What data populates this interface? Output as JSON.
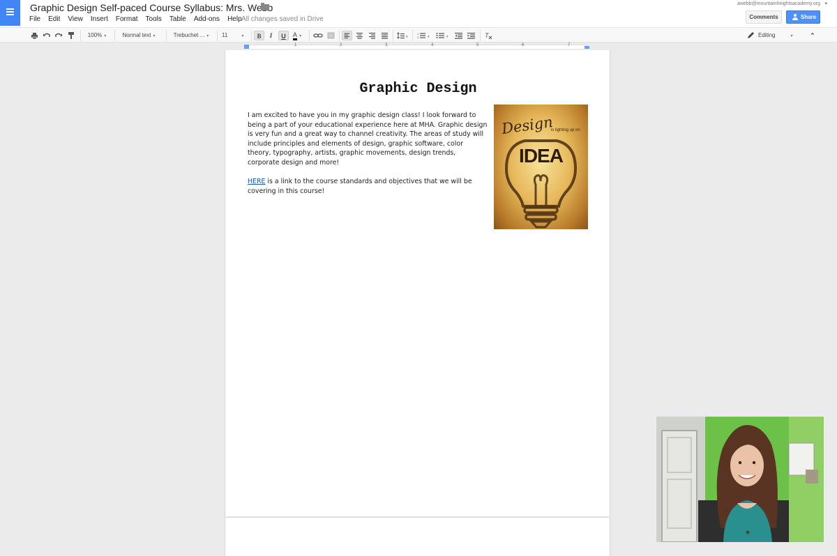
{
  "header": {
    "doc_title": "Graphic Design Self-paced Course Syllabus: Mrs. Webb",
    "menu": [
      "File",
      "Edit",
      "View",
      "Insert",
      "Format",
      "Tools",
      "Table",
      "Add-ons",
      "Help"
    ],
    "save_status": "All changes saved in Drive",
    "account_email": "awebb@mountainheightsacademy.org",
    "comments_label": "Comments",
    "share_label": "Share"
  },
  "toolbar": {
    "zoom": "100%",
    "style": "Normal text",
    "font": "Trebuchet ...",
    "size": "11",
    "bold": "B",
    "italic": "I",
    "underline": "U",
    "text_color": "A",
    "mode": "Editing"
  },
  "ruler": {
    "numbers": [
      "1",
      "2",
      "3",
      "4",
      "5",
      "6",
      "7"
    ]
  },
  "document": {
    "heading": "Graphic Design",
    "paragraph1": "I am excited to have you in my graphic design class! I look forward to being a part of your educational experience here at MHA. Graphic design is very fun and a great way to channel creativity. The areas of study will include principles and elements of design, graphic software, color theory, typography, artists, graphic movements, design trends, corporate design and more!",
    "link_text": "HERE",
    "paragraph2_rest": " is a link to the course standards and objectives that we will be covering in this course!",
    "image": {
      "title": "Design",
      "subtitle": "is lighting up on",
      "word": "IDEA"
    }
  },
  "colors": {
    "docs_blue": "#4285f4",
    "share_blue": "#4d90fe",
    "link_blue": "#1155cc"
  }
}
